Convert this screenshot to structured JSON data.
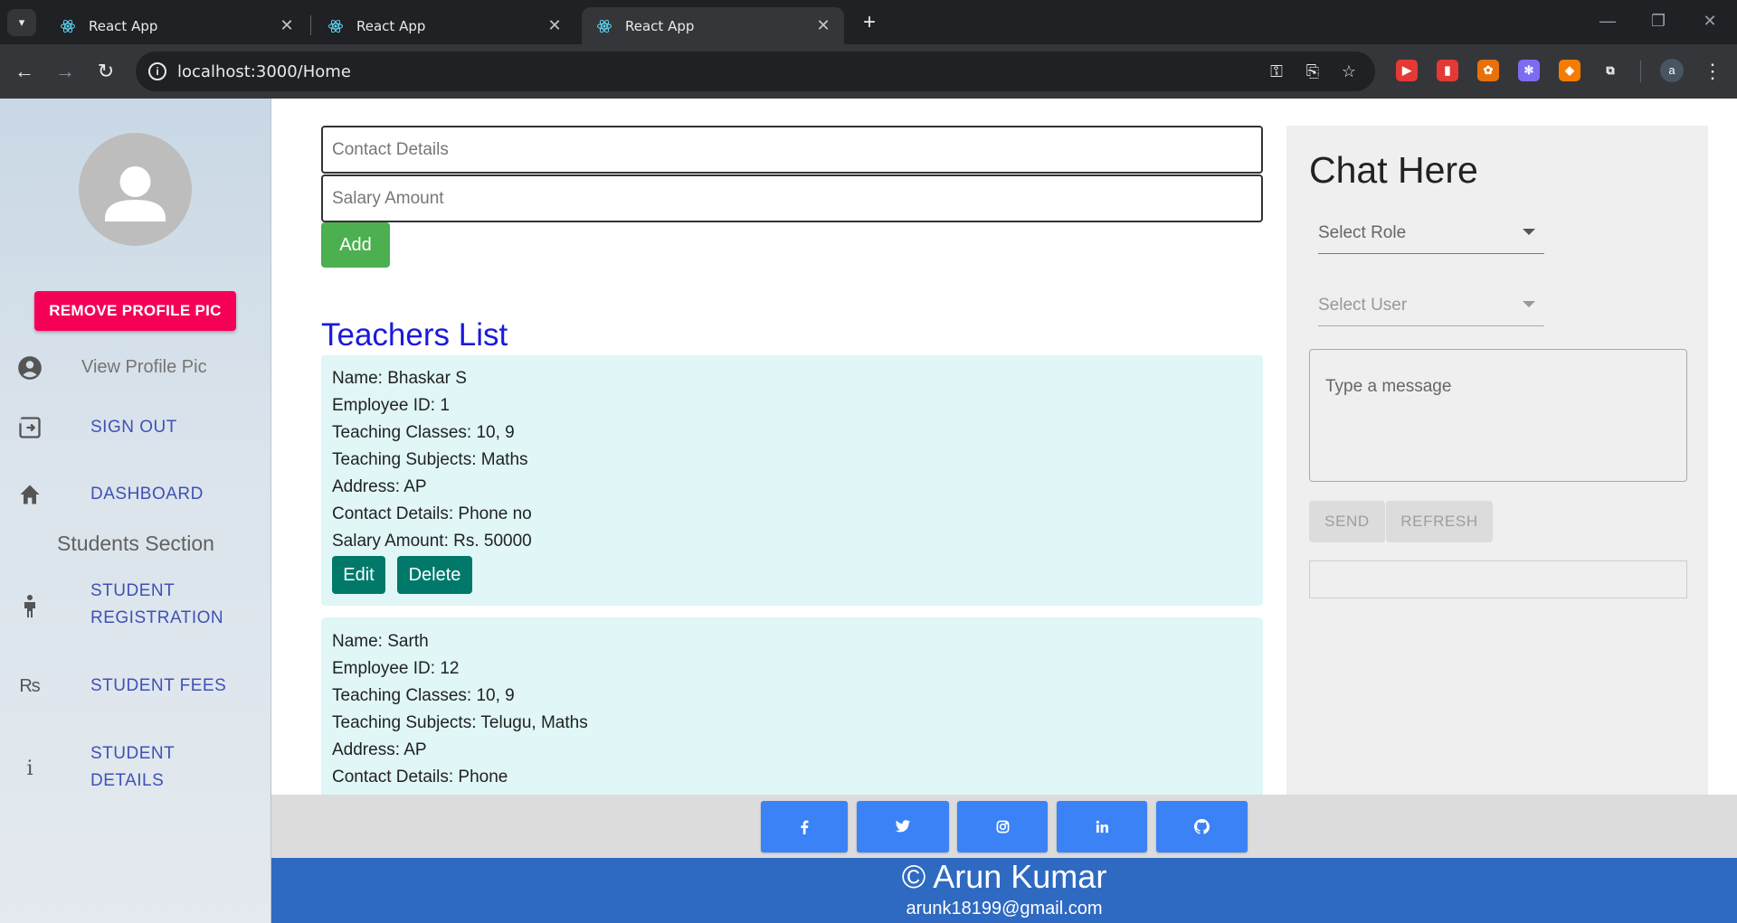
{
  "browser": {
    "tabs": [
      {
        "title": "React App",
        "active": false
      },
      {
        "title": "React App",
        "active": false
      },
      {
        "title": "React App",
        "active": true
      }
    ],
    "url": "localhost:3000/Home",
    "extensions": [
      {
        "icon": "youtube-ext-icon",
        "color": "#e53935",
        "glyph": "▶"
      },
      {
        "icon": "audio-ext-icon",
        "color": "#e53935",
        "glyph": "▮"
      },
      {
        "icon": "film-ext-icon",
        "color": "#e8710a",
        "glyph": "✿"
      },
      {
        "icon": "gear-ext-icon",
        "color": "#7c6cf2",
        "glyph": "✻"
      },
      {
        "icon": "flame-ext-icon",
        "color": "#f57c00",
        "glyph": "◆"
      },
      {
        "icon": "puzzle-icon",
        "color": "#35363a",
        "glyph": "⧉"
      }
    ],
    "profile_initial": "a"
  },
  "sidebar": {
    "remove_pic_label": "REMOVE PROFILE PIC",
    "view_pic_label": "View Profile Pic",
    "sign_out_label": "SIGN OUT",
    "dashboard_label": "DASHBOARD",
    "students_section_title": "Students Section",
    "student_registration_label": "STUDENT REGISTRATION",
    "student_fees_label": "STUDENT FEES",
    "student_details_label": "STUDENT DETAILS",
    "rupee_glyph": "₨"
  },
  "form": {
    "contact_placeholder": "Contact Details",
    "salary_placeholder": "Salary Amount",
    "add_label": "Add"
  },
  "teachers": {
    "title": "Teachers List",
    "edit_label": "Edit",
    "delete_label": "Delete",
    "list": [
      {
        "name": "Name: Bhaskar S",
        "employee_id": "Employee ID: 1",
        "classes": "Teaching Classes: 10, 9",
        "subjects": "Teaching Subjects: Maths",
        "address": "Address: AP",
        "contact": "Contact Details: Phone no",
        "salary": "Salary Amount: Rs. 50000"
      },
      {
        "name": "Name: Sarth",
        "employee_id": "Employee ID: 12",
        "classes": "Teaching Classes: 10, 9",
        "subjects": "Teaching Subjects: Telugu, Maths",
        "address": "Address: AP",
        "contact": "Contact Details: Phone"
      }
    ]
  },
  "chat": {
    "title": "Chat Here",
    "select_role_label": "Select Role",
    "select_user_label": "Select User",
    "message_placeholder": "Type a message",
    "send_label": "SEND",
    "refresh_label": "REFRESH"
  },
  "footer": {
    "social": [
      "facebook-icon",
      "twitter-icon",
      "instagram-icon",
      "linkedin-icon",
      "github-icon"
    ],
    "name": "© Arun Kumar",
    "email": "arunk18199@gmail.com"
  },
  "colors": {
    "remove_btn": "#f50057",
    "add_btn": "#4caf50",
    "edit_btn": "#00796b",
    "title_blue": "#1a1adb",
    "footer_blue": "#2f6ac2",
    "social_blue": "#3b82f6"
  }
}
